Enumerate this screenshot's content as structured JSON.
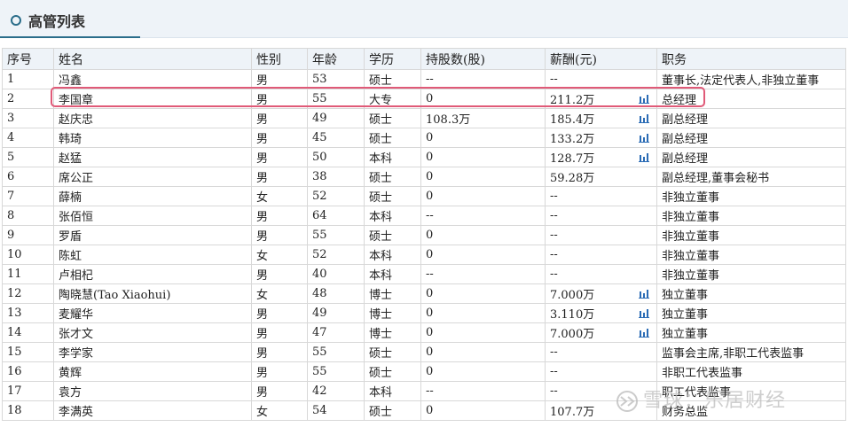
{
  "header": {
    "title": "高管列表"
  },
  "table": {
    "columns": [
      "序号",
      "姓名",
      "性别",
      "年龄",
      "学历",
      "持股数(股)",
      "薪酬(元)",
      "职务"
    ],
    "rows": [
      {
        "no": "1",
        "name": "冯鑫",
        "gender": "男",
        "age": "53",
        "edu": "硕士",
        "shares": "--",
        "salary": "--",
        "chart": false,
        "title": "董事长,法定代表人,非独立董事"
      },
      {
        "no": "2",
        "name": "李国章",
        "gender": "男",
        "age": "55",
        "edu": "大专",
        "shares": "0",
        "salary": "211.2万",
        "chart": true,
        "title": "总经理"
      },
      {
        "no": "3",
        "name": "赵庆忠",
        "gender": "男",
        "age": "49",
        "edu": "硕士",
        "shares": "108.3万",
        "salary": "185.4万",
        "chart": true,
        "title": "副总经理"
      },
      {
        "no": "4",
        "name": "韩琦",
        "gender": "男",
        "age": "45",
        "edu": "硕士",
        "shares": "0",
        "salary": "133.2万",
        "chart": true,
        "title": "副总经理"
      },
      {
        "no": "5",
        "name": "赵猛",
        "gender": "男",
        "age": "50",
        "edu": "本科",
        "shares": "0",
        "salary": "128.7万",
        "chart": true,
        "title": "副总经理"
      },
      {
        "no": "6",
        "name": "席公正",
        "gender": "男",
        "age": "38",
        "edu": "硕士",
        "shares": "0",
        "salary": "59.28万",
        "chart": false,
        "title": "副总经理,董事会秘书"
      },
      {
        "no": "7",
        "name": "薛楠",
        "gender": "女",
        "age": "52",
        "edu": "硕士",
        "shares": "0",
        "salary": "--",
        "chart": false,
        "title": "非独立董事"
      },
      {
        "no": "8",
        "name": "张佰恒",
        "gender": "男",
        "age": "64",
        "edu": "本科",
        "shares": "--",
        "salary": "--",
        "chart": false,
        "title": "非独立董事"
      },
      {
        "no": "9",
        "name": "罗盾",
        "gender": "男",
        "age": "55",
        "edu": "硕士",
        "shares": "0",
        "salary": "--",
        "chart": false,
        "title": "非独立董事"
      },
      {
        "no": "10",
        "name": "陈虹",
        "gender": "女",
        "age": "52",
        "edu": "本科",
        "shares": "0",
        "salary": "--",
        "chart": false,
        "title": "非独立董事"
      },
      {
        "no": "11",
        "name": "卢相杞",
        "gender": "男",
        "age": "40",
        "edu": "本科",
        "shares": "--",
        "salary": "--",
        "chart": false,
        "title": "非独立董事"
      },
      {
        "no": "12",
        "name": "陶晓慧(Tao Xiaohui)",
        "gender": "女",
        "age": "48",
        "edu": "博士",
        "shares": "0",
        "salary": "7.000万",
        "chart": true,
        "title": "独立董事"
      },
      {
        "no": "13",
        "name": "麦耀华",
        "gender": "男",
        "age": "49",
        "edu": "博士",
        "shares": "0",
        "salary": "3.110万",
        "chart": true,
        "title": "独立董事"
      },
      {
        "no": "14",
        "name": "张才文",
        "gender": "男",
        "age": "47",
        "edu": "博士",
        "shares": "0",
        "salary": "7.000万",
        "chart": true,
        "title": "独立董事"
      },
      {
        "no": "15",
        "name": "李学家",
        "gender": "男",
        "age": "55",
        "edu": "硕士",
        "shares": "0",
        "salary": "--",
        "chart": false,
        "title": "监事会主席,非职工代表监事"
      },
      {
        "no": "16",
        "name": "黄辉",
        "gender": "男",
        "age": "55",
        "edu": "硕士",
        "shares": "0",
        "salary": "--",
        "chart": false,
        "title": "非职工代表监事"
      },
      {
        "no": "17",
        "name": "袁方",
        "gender": "男",
        "age": "42",
        "edu": "本科",
        "shares": "--",
        "salary": "--",
        "chart": false,
        "title": "职工代表监事"
      },
      {
        "no": "18",
        "name": "李满英",
        "gender": "女",
        "age": "54",
        "edu": "硕士",
        "shares": "0",
        "salary": "107.7万",
        "chart": false,
        "title": "财务总监"
      }
    ]
  },
  "watermark": {
    "text": "雪球：乐居财经"
  },
  "colors": {
    "accent": "#2a6d8a",
    "highlight": "#e05a78",
    "chart_icon": "#2a6bb5"
  }
}
